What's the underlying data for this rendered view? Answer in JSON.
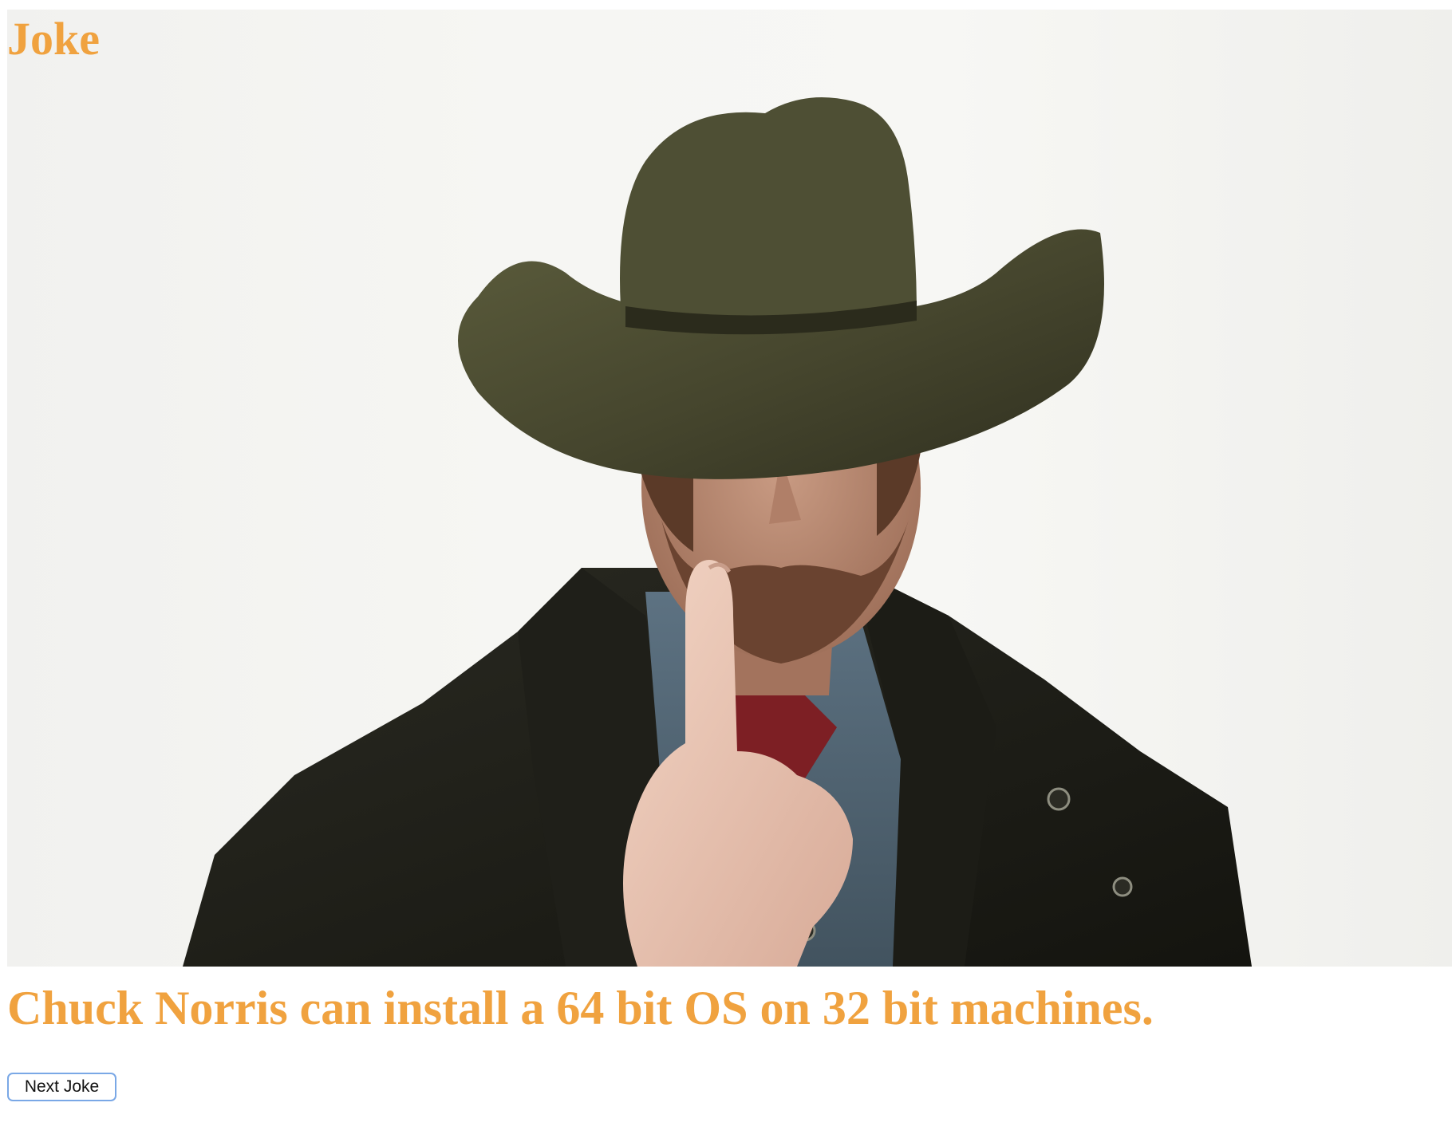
{
  "page": {
    "title": "Joke",
    "joke_text": "Chuck Norris can install a 64 bit OS on 32 bit machines.",
    "next_button_label": "Next Joke"
  },
  "colors": {
    "accent": "#f0a23f",
    "button_focus_border": "#7aa8e6",
    "photo_background": "#f5f5f2"
  },
  "image": {
    "subject": "hero-photo"
  }
}
